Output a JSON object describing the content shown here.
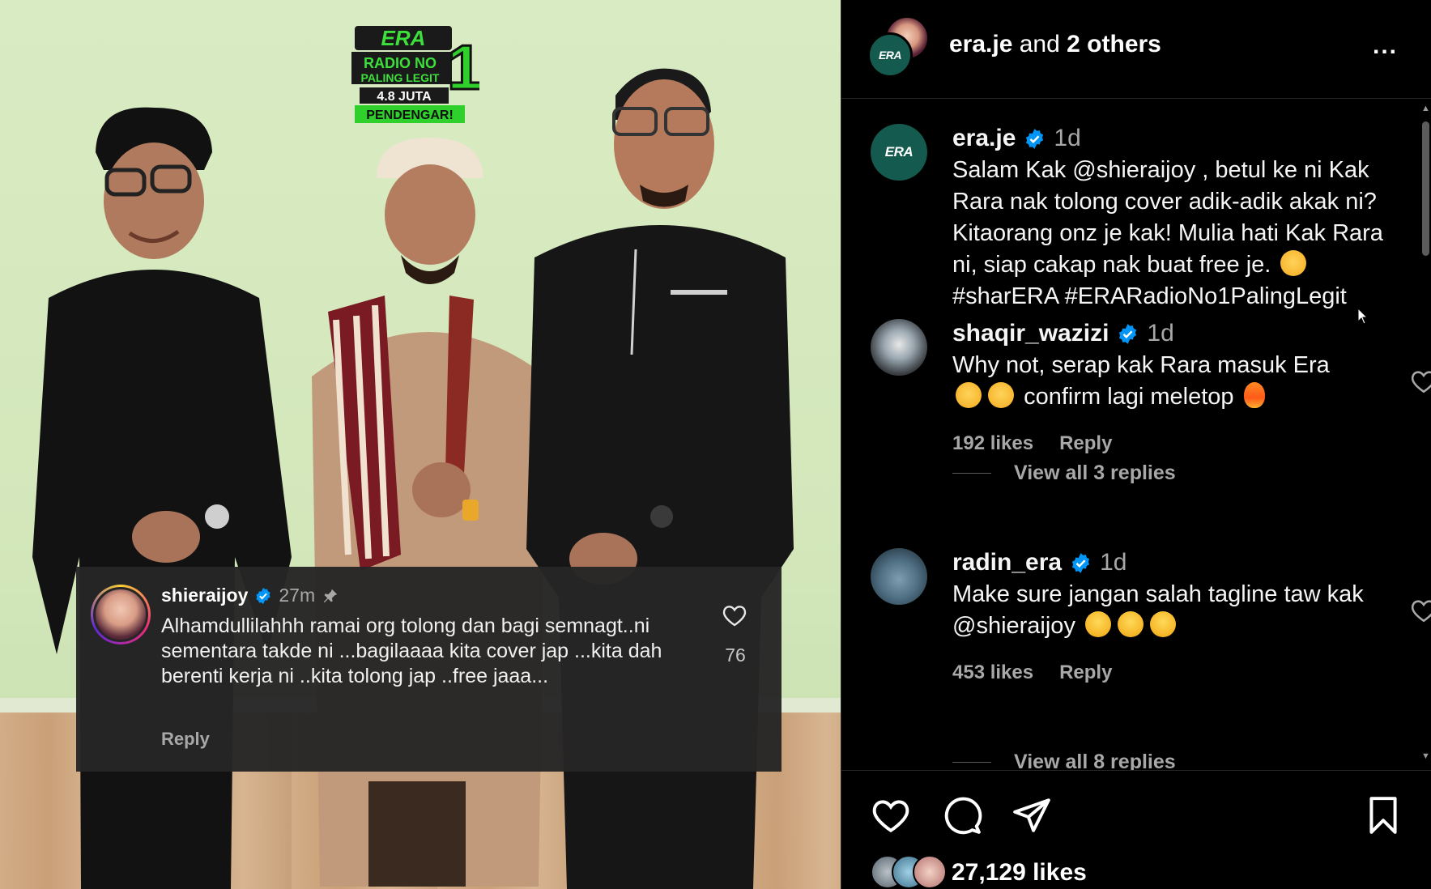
{
  "media": {
    "logo": {
      "brand": "ERA",
      "line1": "RADIO NO",
      "line2": "PALING LEGIT",
      "number": "1",
      "line3": "4.8 JUTA",
      "line4": "PENDENGAR!"
    },
    "overlay_comment": {
      "username": "shieraijoy",
      "time": "27m",
      "text": "Alhamdullilahhh ramai org tolong dan bagi semnagt..ni sementara takde ni ...bagilaaaa kita cover jap ...kita dah berenti kerja ni ..kita tolong jap ..free jaaa...",
      "reply_label": "Reply",
      "like_count": "76",
      "pin_icon": "pin-icon",
      "heart_icon": "heart-outline-icon"
    }
  },
  "header": {
    "primary_user": "era.je",
    "joiner": "and",
    "others": "2 others",
    "more_icon": "more-horizontal-icon",
    "more_label": "..."
  },
  "comments": [
    {
      "username": "era.je",
      "time": "1d",
      "text_parts": [
        "Salam Kak @shieraijoy , betul ke ni Kak Rara nak tolong cover adik-adik akak ni? Kitaorang onz je kak! Mulia hati Kak Rara ni, siap cakap nak buat free je.",
        "#sharERA #ERARadioNo1PalingLegit"
      ],
      "is_caption": true
    },
    {
      "username": "shaqir_wazizi",
      "time": "1d",
      "text_a": "Why not, serap kak Rara masuk Era",
      "text_b": "confirm lagi meletop",
      "likes": "192 likes",
      "reply_label": "Reply",
      "view_replies": "View all 3 replies"
    },
    {
      "username": "radin_era",
      "time": "1d",
      "text": "Make sure jangan salah tagline taw kak @shieraijoy",
      "likes": "453 likes",
      "reply_label": "Reply",
      "view_replies": "View all 8 replies"
    }
  ],
  "actions": {
    "like_icon": "heart-icon",
    "comment_icon": "comment-icon",
    "share_icon": "send-icon",
    "save_icon": "bookmark-icon",
    "likes_total": "27,129 likes"
  },
  "colors": {
    "panel_bg": "#000000",
    "text_primary": "#f5f5f5",
    "text_secondary": "#a8a8a8",
    "verified_blue": "#0095f6",
    "overlay_bg": "#262626",
    "wall": "#d6e9bf"
  }
}
